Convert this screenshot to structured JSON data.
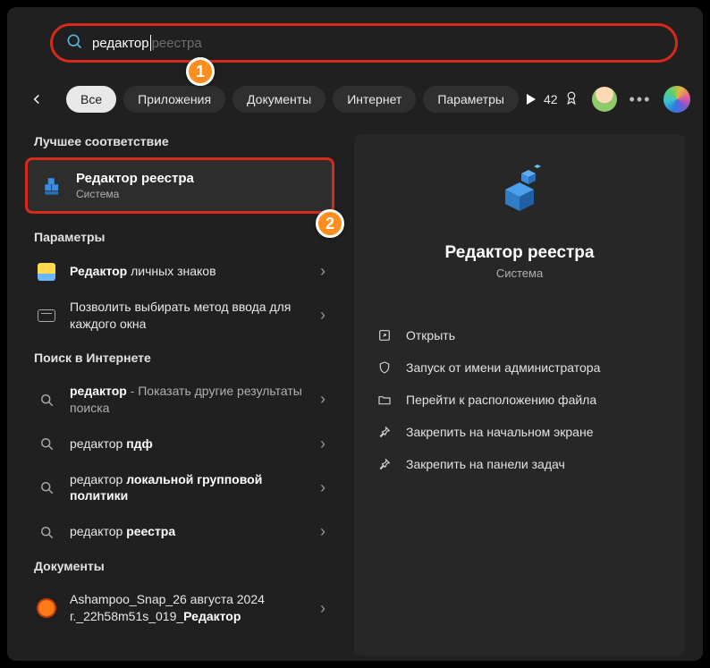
{
  "search": {
    "typed": "редактор",
    "ghost": " реестра"
  },
  "filters": {
    "items": [
      {
        "label": "Все",
        "active": true
      },
      {
        "label": "Приложения",
        "active": false
      },
      {
        "label": "Документы",
        "active": false
      },
      {
        "label": "Интернет",
        "active": false
      },
      {
        "label": "Параметры",
        "active": false
      }
    ],
    "points": "42"
  },
  "annotations": {
    "one": "1",
    "two": "2"
  },
  "left": {
    "best_label": "Лучшее соответствие",
    "best_match": {
      "title": "Редактор реестра",
      "subtitle": "Система"
    },
    "params_label": "Параметры",
    "param_rows": [
      {
        "bold": "Редактор",
        "rest": " личных знаков"
      },
      {
        "bold": "",
        "rest": "Позволить выбирать метод ввода для каждого окна"
      }
    ],
    "web_label": "Поиск в Интернете",
    "web_rows": [
      {
        "q": "редактор",
        "tail": " - Показать другие результаты поиска"
      },
      {
        "q": "редактор ",
        "bold2": "пдф"
      },
      {
        "q": "редактор ",
        "bold2": "локальной групповой политики"
      },
      {
        "q": "редактор ",
        "bold2": "реестра"
      }
    ],
    "docs_label": "Документы",
    "doc_row": {
      "line1": "Ashampoo_Snap_26 августа 2024",
      "line2": "г._22h58m51s_019_",
      "bold": "Редактор"
    }
  },
  "right": {
    "title": "Редактор реестра",
    "subtitle": "Система",
    "actions": [
      "Открыть",
      "Запуск от имени администратора",
      "Перейти к расположению файла",
      "Закрепить на начальном экране",
      "Закрепить на панели задач"
    ]
  }
}
